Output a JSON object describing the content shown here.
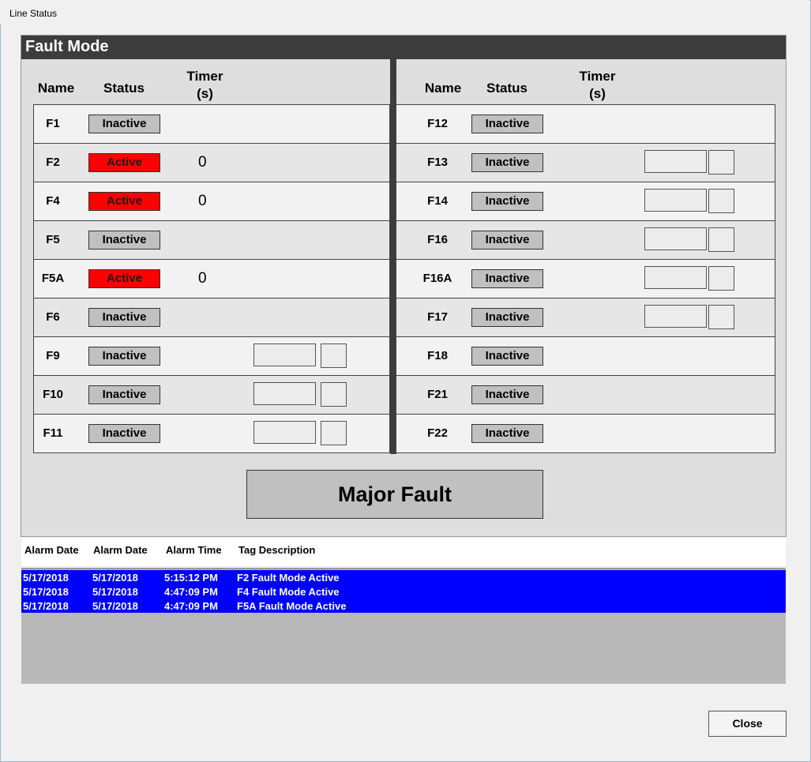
{
  "window": {
    "title": "Line Status"
  },
  "panel": {
    "title": "Fault Mode"
  },
  "headers": {
    "name": "Name",
    "status": "Status",
    "timer_line1": "Timer",
    "timer_line2": "(s)"
  },
  "left_rows": [
    {
      "name": "F1",
      "status": "Inactive",
      "timer": "",
      "boxes": false
    },
    {
      "name": "F2",
      "status": "Active",
      "timer": "0",
      "boxes": false
    },
    {
      "name": "F4",
      "status": "Active",
      "timer": "0",
      "boxes": false
    },
    {
      "name": "F5",
      "status": "Inactive",
      "timer": "",
      "boxes": false
    },
    {
      "name": "F5A",
      "status": "Active",
      "timer": "0",
      "boxes": false
    },
    {
      "name": "F6",
      "status": "Inactive",
      "timer": "",
      "boxes": false
    },
    {
      "name": "F9",
      "status": "Inactive",
      "timer": "",
      "boxes": true
    },
    {
      "name": "F10",
      "status": "Inactive",
      "timer": "",
      "boxes": true
    },
    {
      "name": "F11",
      "status": "Inactive",
      "timer": "",
      "boxes": true
    }
  ],
  "right_rows": [
    {
      "name": "F12",
      "status": "Inactive",
      "timer": "",
      "boxes": false
    },
    {
      "name": "F13",
      "status": "Inactive",
      "timer": "",
      "boxes": true
    },
    {
      "name": "F14",
      "status": "Inactive",
      "timer": "",
      "boxes": true
    },
    {
      "name": "F16",
      "status": "Inactive",
      "timer": "",
      "boxes": true
    },
    {
      "name": "F16A",
      "status": "Inactive",
      "timer": "",
      "boxes": true
    },
    {
      "name": "F17",
      "status": "Inactive",
      "timer": "",
      "boxes": true
    },
    {
      "name": "F18",
      "status": "Inactive",
      "timer": "",
      "boxes": false
    },
    {
      "name": "F21",
      "status": "Inactive",
      "timer": "",
      "boxes": false
    },
    {
      "name": "F22",
      "status": "Inactive",
      "timer": "",
      "boxes": false
    }
  ],
  "major_fault": {
    "label": "Major Fault"
  },
  "alarm_table": {
    "columns": [
      "Alarm Date",
      "Alarm Date",
      "Alarm Time",
      "Tag Description"
    ],
    "rows": [
      [
        "5/17/2018",
        "5/17/2018",
        "5:15:12 PM",
        "F2 Fault Mode Active"
      ],
      [
        "5/17/2018",
        "5/17/2018",
        "4:47:09 PM",
        "F4 Fault Mode Active"
      ],
      [
        "5/17/2018",
        "5/17/2018",
        "4:47:09 PM",
        "F5A Fault Mode Active"
      ]
    ]
  },
  "buttons": {
    "close": "Close"
  },
  "colors": {
    "active": "#ff0000",
    "inactive": "#c0c0c0",
    "header_bar": "#3c3c3c",
    "alarm_highlight": "#0000ff"
  }
}
